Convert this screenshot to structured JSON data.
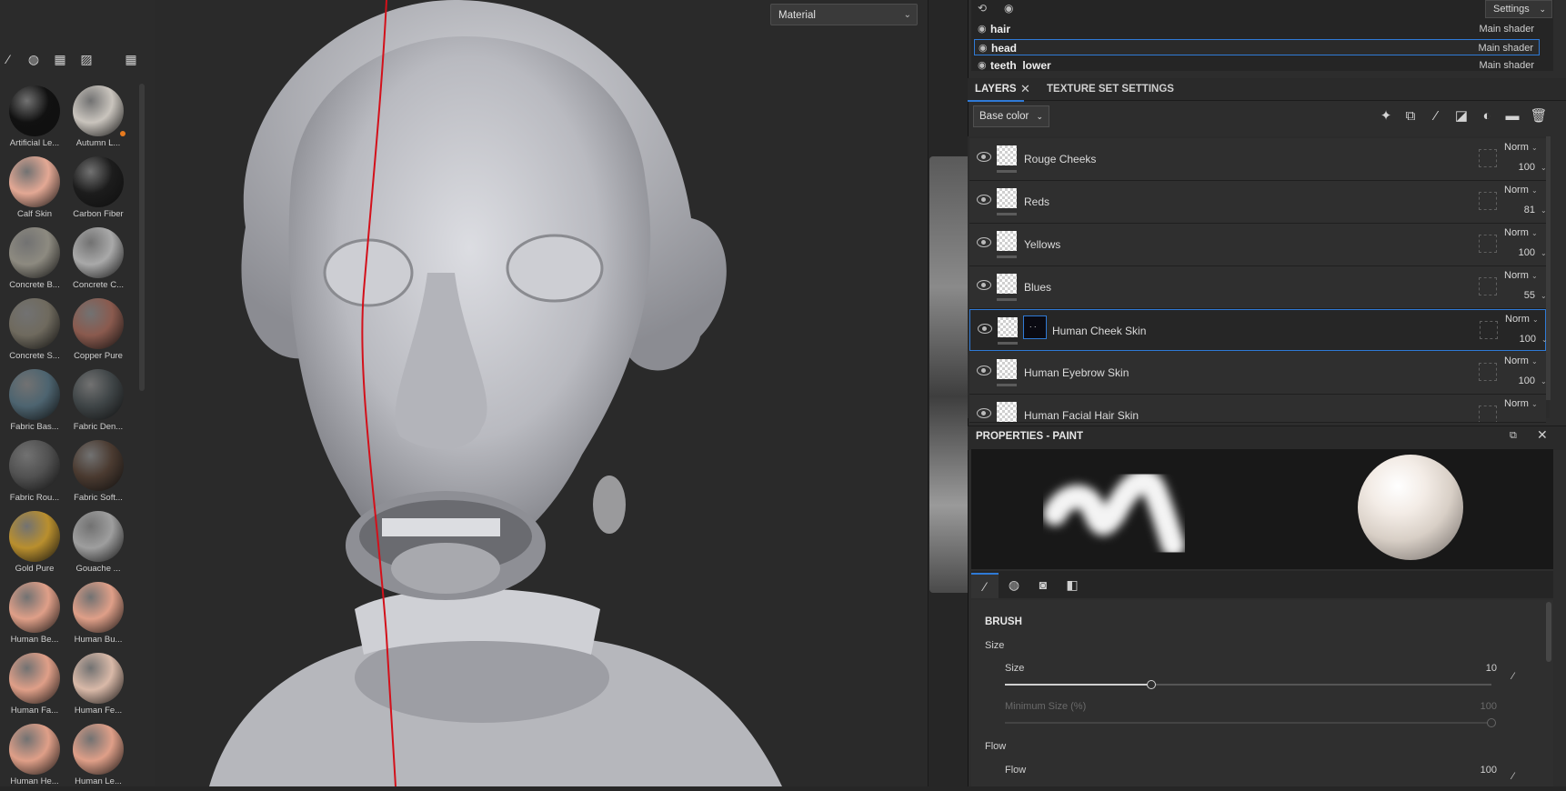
{
  "shelf": {
    "materials": [
      {
        "name": "Artificial Le...",
        "color": "#111111",
        "badge": false
      },
      {
        "name": "Autumn L...",
        "color": "#c9c4bd",
        "badge": true
      },
      {
        "name": "Calf Skin",
        "color": "#e3a894",
        "badge": false
      },
      {
        "name": "Carbon Fiber",
        "color": "#1c1c1c",
        "badge": false
      },
      {
        "name": "Concrete B...",
        "color": "#8d8a80",
        "badge": false
      },
      {
        "name": "Concrete C...",
        "color": "#a9a9a9",
        "badge": false
      },
      {
        "name": "Concrete S...",
        "color": "#6f6a5e",
        "badge": false
      },
      {
        "name": "Copper Pure",
        "color": "#8a5a4e",
        "badge": false
      },
      {
        "name": "Fabric Bas...",
        "color": "#4d6470",
        "badge": false
      },
      {
        "name": "Fabric Den...",
        "color": "#3f4547",
        "badge": false
      },
      {
        "name": "Fabric Rou...",
        "color": "#515151",
        "badge": false
      },
      {
        "name": "Fabric Soft...",
        "color": "#4a3a30",
        "badge": false
      },
      {
        "name": "Gold Pure",
        "color": "#b98f2e",
        "badge": false
      },
      {
        "name": "Gouache ...",
        "color": "#9e9e9e",
        "badge": false
      },
      {
        "name": "Human Be...",
        "color": "#df9f88",
        "badge": false
      },
      {
        "name": "Human Bu...",
        "color": "#df9f88",
        "badge": false
      },
      {
        "name": "Human Fa...",
        "color": "#df9f88",
        "badge": false
      },
      {
        "name": "Human Fe...",
        "color": "#d9b9a8",
        "badge": false
      },
      {
        "name": "Human He...",
        "color": "#df9f88",
        "badge": false
      },
      {
        "name": "Human Le...",
        "color": "#df9f88",
        "badge": false
      }
    ]
  },
  "viewport": {
    "material_mode": "Material"
  },
  "texture_sets": {
    "settings_label": "Settings",
    "rows": [
      {
        "name": "hair",
        "shader": "Main shader"
      },
      {
        "name": "head",
        "shader": "Main shader"
      },
      {
        "name": "teeth_lower",
        "shader": "Main shader"
      }
    ]
  },
  "layers_panel": {
    "tab_layers": "LAYERS",
    "tab_texture_set": "TEXTURE SET SETTINGS",
    "channel": "Base color",
    "layers": [
      {
        "name": "Rouge Cheeks",
        "blend": "Norm",
        "opacity": "100"
      },
      {
        "name": "Reds",
        "blend": "Norm",
        "opacity": "81"
      },
      {
        "name": "Yellows",
        "blend": "Norm",
        "opacity": "100"
      },
      {
        "name": "Blues",
        "blend": "Norm",
        "opacity": "55"
      },
      {
        "name": "Human Cheek Skin",
        "blend": "Norm",
        "opacity": "100"
      },
      {
        "name": "Human Eyebrow Skin",
        "blend": "Norm",
        "opacity": "100"
      },
      {
        "name": "Human Facial Hair Skin",
        "blend": "Norm",
        "opacity": ""
      }
    ]
  },
  "properties": {
    "title": "PROPERTIES - PAINT",
    "section": "BRUSH",
    "size_group": "Size",
    "size_label": "Size",
    "size_value": "10",
    "size_fraction": 0.3,
    "min_size_label": "Minimum Size (%)",
    "min_size_value": "100",
    "flow_group": "Flow",
    "flow_label": "Flow",
    "flow_value": "100"
  }
}
